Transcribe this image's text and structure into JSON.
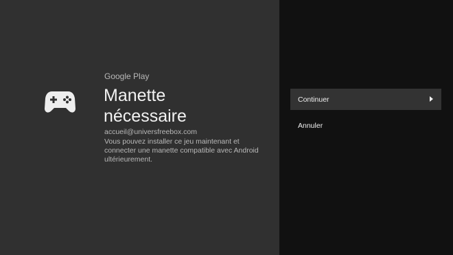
{
  "dialog": {
    "brand": "Google Play",
    "title_line1": "Manette",
    "title_line2": "nécessaire",
    "account": "accueil@universfreebox.com",
    "description": "Vous pouvez installer ce jeu maintenant et connecter une manette compatible avec Android ultérieurement.",
    "icon": "gamepad-icon"
  },
  "actions": {
    "continue_label": "Continuer",
    "cancel_label": "Annuler",
    "continue_icon": "play-arrow-icon"
  },
  "colors": {
    "left_background": "#303030",
    "right_background": "#111111",
    "focused_item": "#333333",
    "title_text": "#f2f2f2",
    "secondary_text": "#b9b9b9"
  }
}
